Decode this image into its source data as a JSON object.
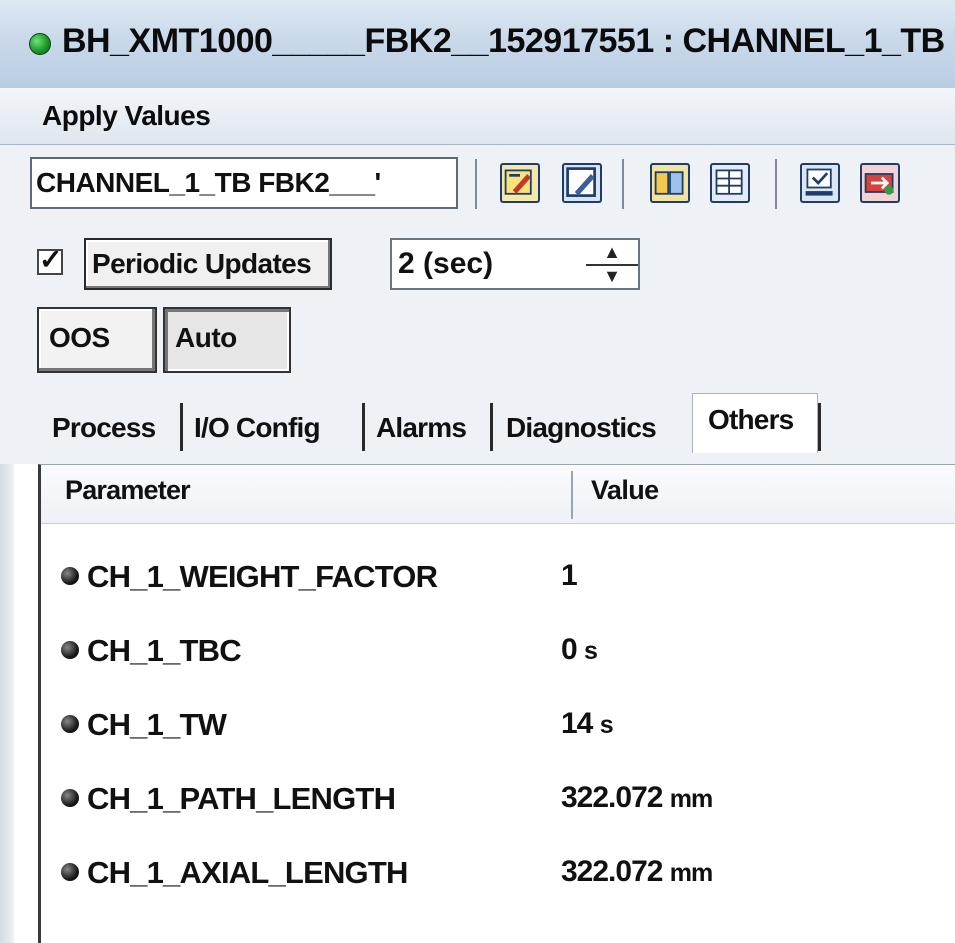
{
  "window": {
    "title": "BH_XMT1000_____FBK2__152917551 : CHANNEL_1_TB"
  },
  "menu": {
    "apply_values": "Apply Values"
  },
  "toolbar": {
    "block_selector_value": "CHANNEL_1_TB   FBK2___'",
    "icons": [
      "edit-icon",
      "edit-box-icon",
      "compare-icon",
      "grid-icon",
      "download-icon",
      "transfer-icon"
    ]
  },
  "periodic": {
    "checkbox_checked": true,
    "checkbox_mark": "✓",
    "label": "Periodic Updates",
    "interval_value": "2 (sec)",
    "spin_up": "▲",
    "spin_down": "▼"
  },
  "mode": {
    "oos_label": "OOS",
    "auto_label": "Auto"
  },
  "tabs": [
    {
      "label": "Process",
      "active": false
    },
    {
      "label": "I/O Config",
      "active": false
    },
    {
      "label": "Alarms",
      "active": false
    },
    {
      "label": "Diagnostics",
      "active": false
    },
    {
      "label": "Others",
      "active": true
    }
  ],
  "grid": {
    "headers": {
      "parameter": "Parameter",
      "value": "Value"
    },
    "rows": [
      {
        "name": "CH_1_WEIGHT_FACTOR",
        "value": "1",
        "unit": ""
      },
      {
        "name": "CH_1_TBC",
        "value": "0",
        "unit": "s"
      },
      {
        "name": "CH_1_TW",
        "value": "14",
        "unit": "s"
      },
      {
        "name": "CH_1_PATH_LENGTH",
        "value": "322.072",
        "unit": "mm"
      },
      {
        "name": "CH_1_AXIAL_LENGTH",
        "value": "322.072",
        "unit": "mm"
      }
    ]
  }
}
